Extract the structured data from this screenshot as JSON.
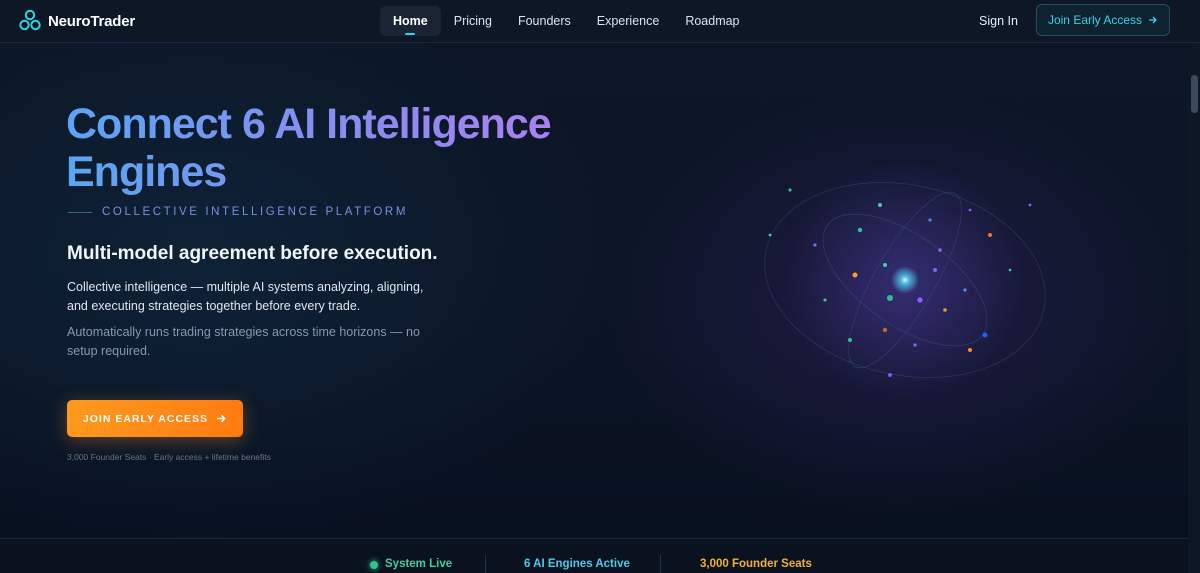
{
  "nav": {
    "brand": "NeuroTrader",
    "items": [
      {
        "label": "Home",
        "active": true
      },
      {
        "label": "Pricing",
        "active": false
      },
      {
        "label": "Founders",
        "active": false
      },
      {
        "label": "Experience",
        "active": false
      },
      {
        "label": "Roadmap",
        "active": false
      }
    ],
    "signin": "Sign In",
    "cta": "Join Early Access"
  },
  "hero": {
    "title": "Connect 6 AI Intelligence Engines",
    "tagline": "COLLECTIVE INTELLIGENCE PLATFORM",
    "subheading": "Multi-model agreement before execution.",
    "description": "Collective intelligence — multiple AI systems analyzing, aligning, and executing strategies together before every trade.",
    "secondary": "Automatically runs trading strategies across time horizons — no setup required.",
    "cta": "JOIN EARLY ACCESS",
    "note": "3,000 Founder Seats · Early access + lifetime benefits"
  },
  "status": {
    "live": "System Live",
    "engines": "6 AI Engines Active",
    "seats": "3,000 Founder Seats"
  },
  "colors": {
    "accent_cyan": "#2fd6e0",
    "accent_orange": "#ff8a18",
    "live_green": "#3ecf9a",
    "seats_gold": "#f2b03a"
  },
  "icons": [
    "logo-icon",
    "arrow-right-icon",
    "live-dot-icon"
  ]
}
